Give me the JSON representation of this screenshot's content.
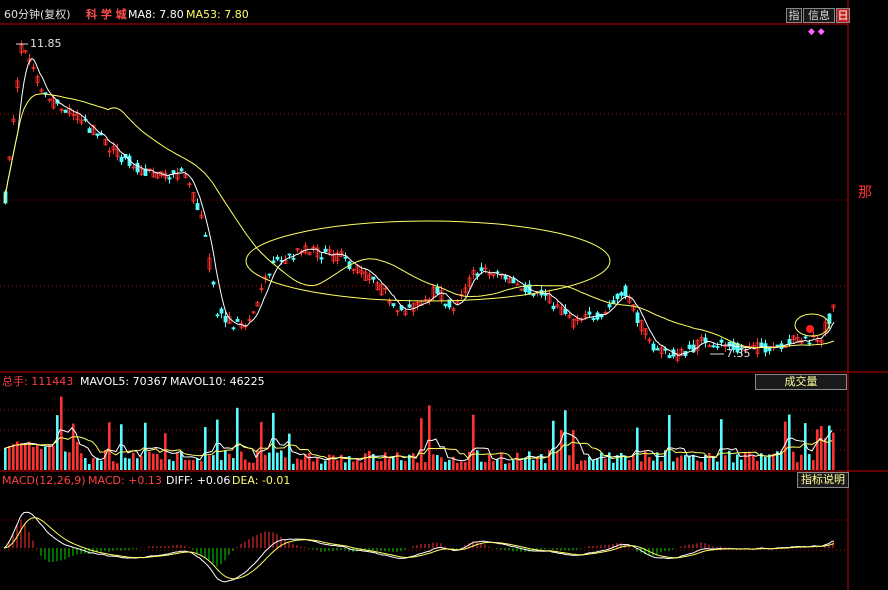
{
  "header": {
    "period": "60分钟(复权)",
    "stock_name": "科 学 城",
    "ma8_label": "MA8: 7.80",
    "ma53_label": "MA53: 7.80",
    "btn_indicator": "指",
    "btn_info": "信息",
    "btn_small": "日"
  },
  "price_panel": {
    "high_label": "11.85",
    "low_label": "7.35",
    "side_char": "那",
    "high_value": 11.85,
    "low_value": 7.35
  },
  "volume_panel": {
    "total_label": "总手: 111443",
    "mavol5_label": "MAVOL5: 70367",
    "mavol10_label": "MAVOL10: 46225",
    "button": "成交量"
  },
  "macd_panel": {
    "macd_name": "MACD(12,26,9)",
    "macd_label": "MACD: +0.13",
    "diff_label": "DIFF: +0.06",
    "dea_label": "DEA: -0.01",
    "button": "指标说明"
  },
  "colors": {
    "up": "#ff3232",
    "down": "#54fcfc",
    "ma_white": "#ffffff",
    "ma_yellow": "#ffff66",
    "grid": "#b00000",
    "macd_neg": "#00d800",
    "highlight": "#ff2020"
  },
  "chart_data": {
    "type": "candlestick",
    "price_range": [
      7.0,
      12.2
    ],
    "candles": [],
    "annotations": [
      "11.85",
      "7.35"
    ]
  }
}
